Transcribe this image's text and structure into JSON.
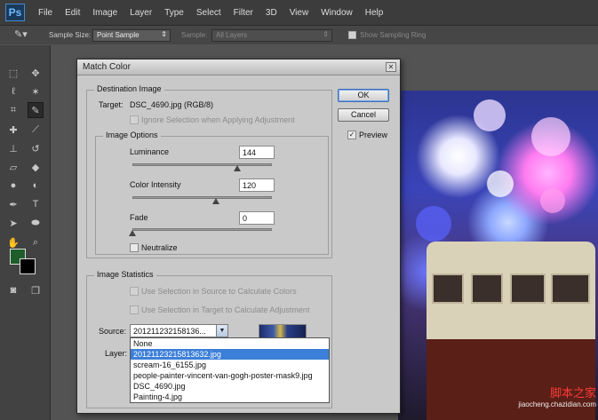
{
  "app": {
    "logo": "Ps"
  },
  "menu": [
    "File",
    "Edit",
    "Image",
    "Layer",
    "Type",
    "Select",
    "Filter",
    "3D",
    "View",
    "Window",
    "Help"
  ],
  "options_bar": {
    "sample_size_label": "Sample Size:",
    "sample_size_value": "Point Sample",
    "sample_label": "Sample:",
    "sample_value": "All Layers",
    "show_ring_label": "Show Sampling Ring"
  },
  "colors": {
    "foreground": "#1f5d2a",
    "background": "#000000",
    "accent": "#3c7fd8"
  },
  "dialog": {
    "title": "Match Color",
    "destination": {
      "title": "Destination Image",
      "target_label": "Target:",
      "target_value": "DSC_4690.jpg (RGB/8)",
      "ignore_selection": "Ignore Selection when Applying Adjustment"
    },
    "image_options": {
      "title": "Image Options",
      "luminance_label": "Luminance",
      "luminance_value": "144",
      "luminance_fraction": 0.75,
      "intensity_label": "Color Intensity",
      "intensity_value": "120",
      "intensity_fraction": 0.6,
      "fade_label": "Fade",
      "fade_value": "0",
      "fade_fraction": 0,
      "neutralize_label": "Neutralize"
    },
    "image_statistics": {
      "title": "Image Statistics",
      "use_source": "Use Selection in Source to Calculate Colors",
      "use_target": "Use Selection in Target to Calculate Adjustment",
      "source_label": "Source:",
      "source_value": "201211232158136...",
      "layer_label": "Layer:"
    },
    "buttons": {
      "ok": "OK",
      "cancel": "Cancel",
      "preview": "Preview"
    },
    "preview_checked": "✓"
  },
  "source_options": [
    "None",
    "20121123215813632.jpg",
    "scream-16_6155.jpg",
    "people-painter-vincent-van-gogh-poster-mask9.jpg",
    "DSC_4690.jpg",
    "Painting-4.jpg"
  ],
  "selected_source_index": 1,
  "watermark": {
    "line1": "脚本之家",
    "line2": "jiaocheng.chazidian.com"
  }
}
